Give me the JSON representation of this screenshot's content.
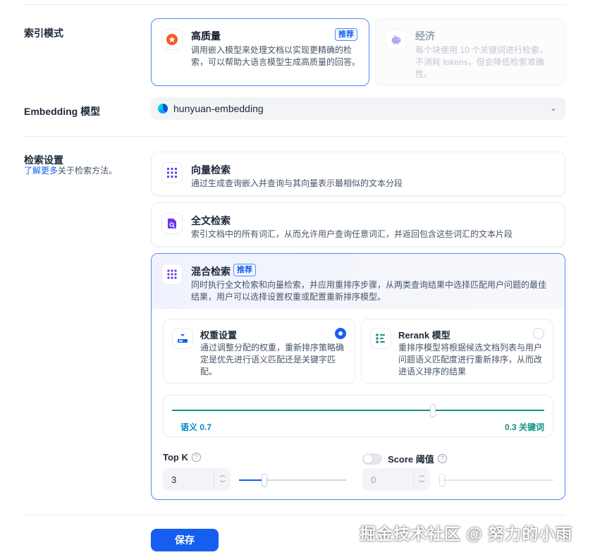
{
  "index_mode": {
    "label": "索引模式",
    "high_quality": {
      "title": "高质量",
      "badge": "推荐",
      "description": "调用嵌入模型来处理文档以实现更精确的检索，可以帮助大语言模型生成高质量的回答。",
      "icon": "star-icon",
      "accent": "#f15b22"
    },
    "economy": {
      "title": "经济",
      "description": "每个块使用 10 个关键词进行检索，不消耗 tokens，但会降低检索准确性。",
      "icon": "piggy-bank-icon"
    }
  },
  "embedding": {
    "label": "Embedding 模型",
    "value": "hunyuan-embedding",
    "icon": "hunyuan-logo-icon"
  },
  "retrieval": {
    "label": "检索设置",
    "sub_link": "了解更多",
    "sub_text": "关于检索方法。",
    "vector": {
      "title": "向量检索",
      "description": "通过生成查询嵌入并查询与其向量表示最相似的文本分段",
      "icon": "grid-icon"
    },
    "fulltext": {
      "title": "全文检索",
      "description": "索引文档中的所有词汇，从而允许用户查询任意词汇，并返回包含这些词汇的文本片段",
      "icon": "document-search-icon"
    },
    "hybrid": {
      "title": "混合检索",
      "badge": "推荐",
      "description": "同时执行全文检索和向量检索，并应用重排序步骤，从两类查询结果中选择匹配用户问题的最佳结果，用户可以选择设置权重或配置重新排序模型。",
      "icon": "dots-grid-icon",
      "weight": {
        "title": "权重设置",
        "description": "通过调整分配的权重，重新排序策略确定是优先进行语义匹配还是关键字匹配。",
        "selected": true,
        "icon": "balance-icon"
      },
      "rerank": {
        "title": "Rerank 模型",
        "description": "重排序模型将根据候选文档列表与用户问题语义匹配度进行重新排序，从而改进语义排序的结果",
        "selected": false,
        "icon": "rerank-icon"
      },
      "weight_slider": {
        "semantic_label": "语义 0.7",
        "keyword_label": "0.3 关键词",
        "semantic_value": 0.7,
        "keyword_value": 0.3
      },
      "top_k": {
        "label": "Top K",
        "value": "3",
        "slider_fraction": 0.24
      },
      "score": {
        "label": "Score 阈值",
        "value": "0",
        "enabled": false,
        "slider_fraction": 0.0
      }
    }
  },
  "actions": {
    "save_label": "保存"
  },
  "watermark": "掘金技术社区 @ 努力的小雨",
  "colors": {
    "primary": "#155eef",
    "semantic": "#0086c9",
    "keyword": "#0e9384"
  }
}
